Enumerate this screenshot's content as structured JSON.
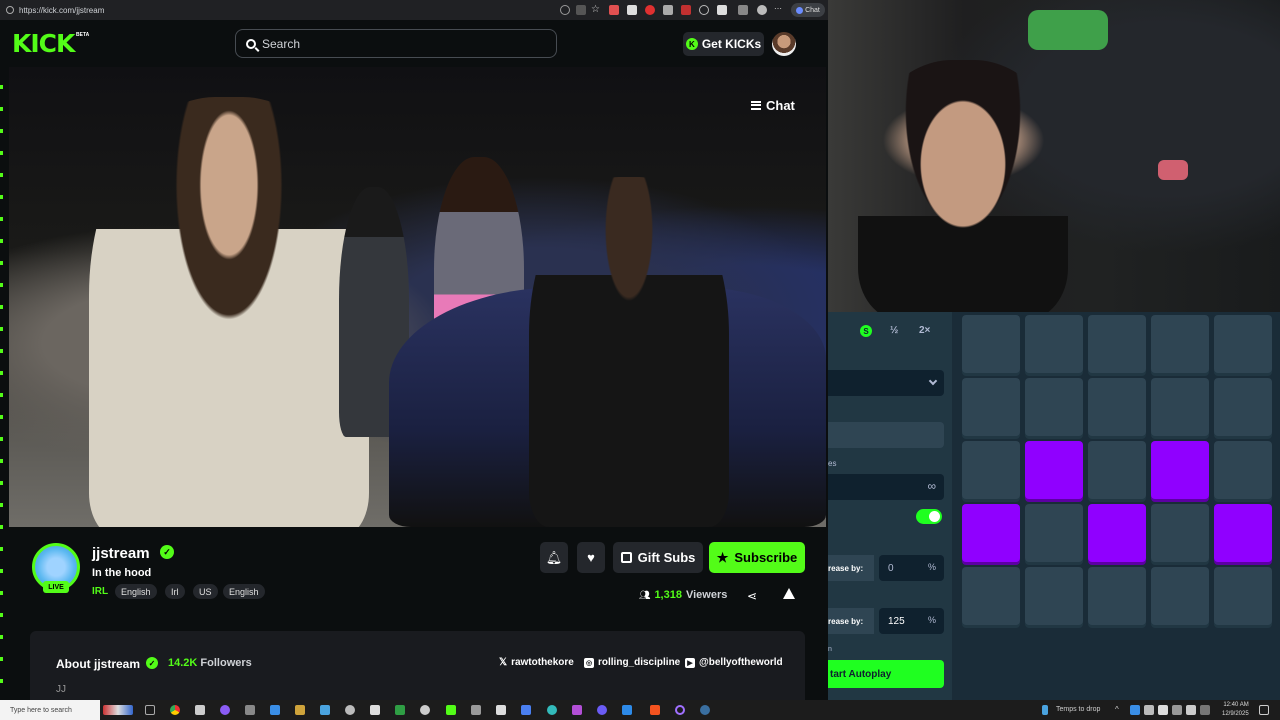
{
  "browser": {
    "url": "https://kick.com/jjstream",
    "chat_tab_label": "Chat"
  },
  "header": {
    "logo": "KICK",
    "logo_badge": "BETA",
    "search_placeholder": "Search",
    "get_kicks_label": "Get KICKs"
  },
  "video": {
    "chat_toggle_label": "Chat"
  },
  "stream": {
    "streamer": "jjstream",
    "live_label": "LIVE",
    "title": "In the hood",
    "category": "IRL",
    "tags": [
      "English",
      "Irl",
      "US",
      "English"
    ],
    "gift_subs_label": "Gift Subs",
    "subscribe_label": "Subscribe",
    "viewer_count": "1,318",
    "viewer_label": "Viewers"
  },
  "about": {
    "title": "About jjstream",
    "followers_count": "14.2K",
    "followers_label": "Followers",
    "socials": [
      "rawtothekore",
      "rolling_discipline",
      "@bellyoftheworld"
    ],
    "bio": "JJ"
  },
  "game": {
    "speed_s": "S",
    "speed_half": "½",
    "speed_double": "2×",
    "games_label": "es",
    "increase_label_1": "rease by:",
    "increase_value_1": "0",
    "increase_label_2": "rease by:",
    "increase_value_2": "125",
    "percent": "%",
    "infinite": "∞",
    "small_label": "n",
    "autoplay_label": "tart Autoplay",
    "grid": [
      [
        0,
        0,
        0,
        0,
        0
      ],
      [
        0,
        0,
        0,
        0,
        0
      ],
      [
        0,
        1,
        0,
        1,
        0
      ],
      [
        1,
        0,
        1,
        0,
        1
      ],
      [
        0,
        0,
        0,
        0,
        0
      ]
    ],
    "accent": "#1fff20",
    "selected_color": "#9000ff"
  },
  "taskbar": {
    "search_placeholder": "Type here to search",
    "tray_text": "Temps to drop",
    "time": "12:40 AM",
    "date": "12/9/2025"
  },
  "colors": {
    "kick_green": "#53fc18",
    "background": "#0b0e0f"
  }
}
